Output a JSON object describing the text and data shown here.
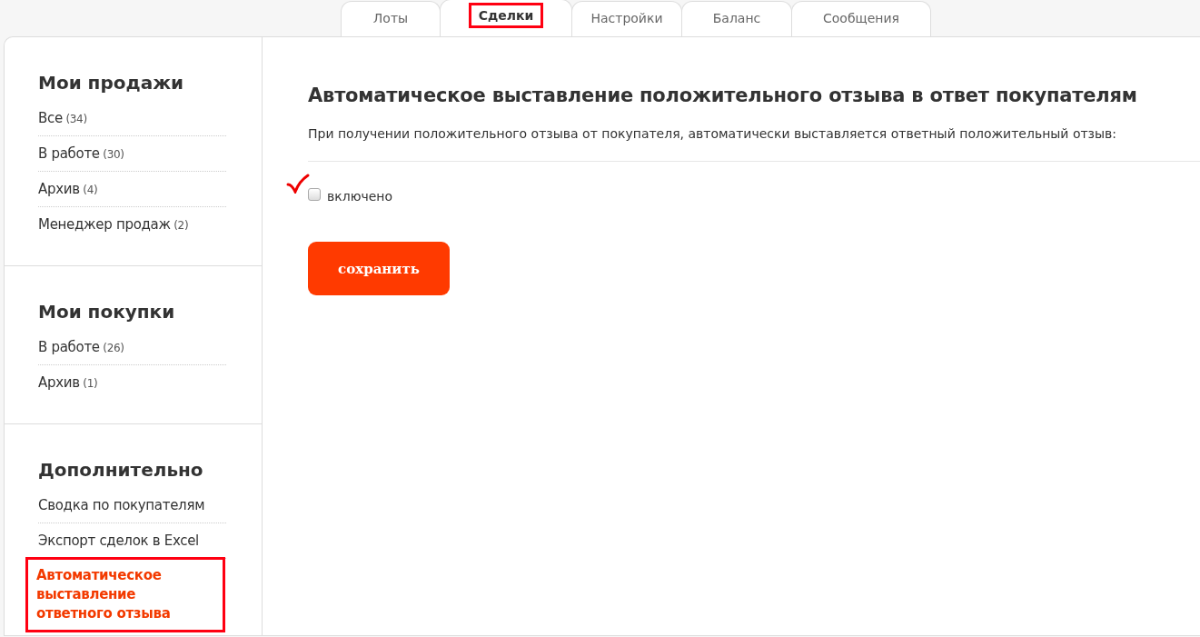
{
  "tabs": [
    {
      "label": "Лоты",
      "selected": false,
      "annotated": false
    },
    {
      "label": "Сделки",
      "selected": true,
      "annotated": true
    },
    {
      "label": "Настройки",
      "selected": false,
      "annotated": false
    },
    {
      "label": "Баланс",
      "selected": false,
      "annotated": false
    },
    {
      "label": "Сообщения",
      "selected": false,
      "annotated": false
    }
  ],
  "sidebar": {
    "sections": [
      {
        "title": "Мои продажи",
        "items": [
          {
            "label": "Все",
            "count": "(34)",
            "selected": false,
            "annotated": false
          },
          {
            "label": "В работе",
            "count": "(30)",
            "selected": false,
            "annotated": false
          },
          {
            "label": "Архив",
            "count": "(4)",
            "selected": false,
            "annotated": false
          },
          {
            "label": "Менеджер продаж",
            "count": "(2)",
            "selected": false,
            "annotated": false
          }
        ]
      },
      {
        "title": "Мои покупки",
        "items": [
          {
            "label": "В работе",
            "count": "(26)",
            "selected": false,
            "annotated": false
          },
          {
            "label": "Архив",
            "count": "(1)",
            "selected": false,
            "annotated": false
          }
        ]
      },
      {
        "title": "Дополнительно",
        "items": [
          {
            "label": "Сводка по покупателям",
            "selected": false,
            "annotated": false
          },
          {
            "label": "Экспорт сделок в Excel",
            "selected": false,
            "annotated": false
          },
          {
            "label": "Автоматическое выставление ответного отзыва",
            "selected": true,
            "annotated": true
          }
        ]
      }
    ]
  },
  "content": {
    "title": "Автоматическое выставление положительного отзыва в ответ покупателям",
    "description": "При получении положительного отзыва от покупателя, автоматически выставляется ответный положительный отзыв:",
    "checkbox": {
      "label": "включено",
      "checked": false,
      "annotated": true
    },
    "save_button": "сохранить"
  }
}
